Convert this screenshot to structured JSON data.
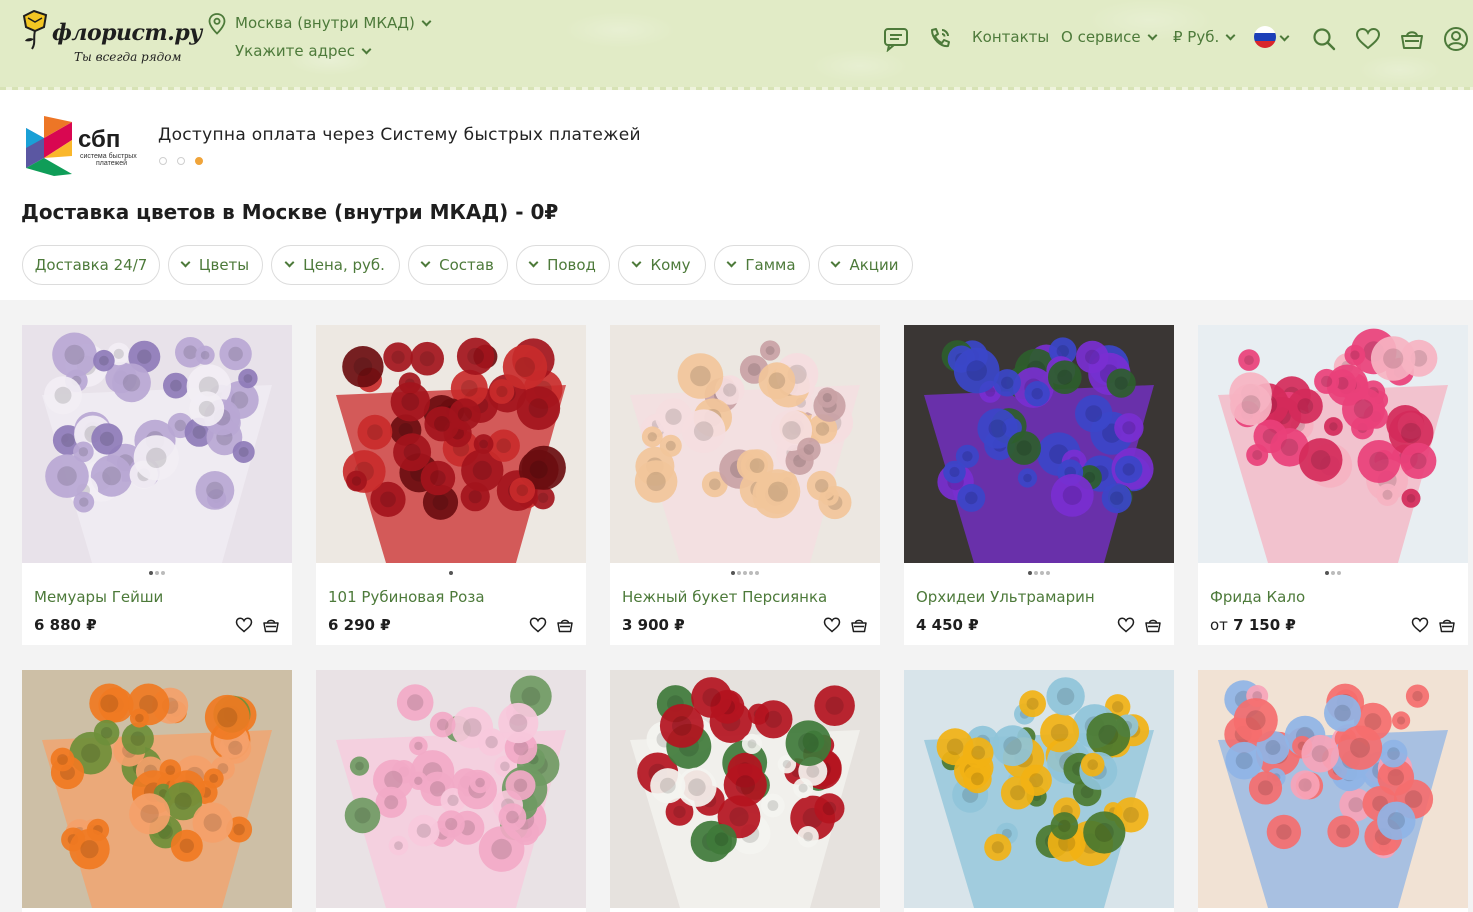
{
  "header": {
    "logo_text": "флорист.ру",
    "logo_slogan": "Ты всегда рядом",
    "city": "Москва (внутри МКАД)",
    "address_prompt": "Укажите адрес",
    "nav": {
      "contacts": "Контакты",
      "about": "О сервисе",
      "currency": "₽ Руб."
    },
    "icons": [
      "chat-icon",
      "phone-icon",
      "flag-russia-icon",
      "search-icon",
      "heart-icon",
      "basket-icon",
      "user-icon"
    ]
  },
  "banner": {
    "sbp_logo_text": "сбп",
    "sbp_logo_sub1": "система быстрых",
    "sbp_logo_sub2": "платежей",
    "text": "Доступна оплата через Систему быстрых платежей",
    "slides": 3,
    "active_slide": 3
  },
  "page_title": "Доставка цветов в Москве (внутри МКАД) - 0₽",
  "filters": [
    {
      "label": "Доставка 24/7",
      "chevron": false
    },
    {
      "label": "Цветы",
      "chevron": true
    },
    {
      "label": "Цена, руб.",
      "chevron": true
    },
    {
      "label": "Состав",
      "chevron": true
    },
    {
      "label": "Повод",
      "chevron": true
    },
    {
      "label": "Кому",
      "chevron": true
    },
    {
      "label": "Гамма",
      "chevron": true
    },
    {
      "label": "Акции",
      "chevron": true
    }
  ],
  "products": [
    {
      "name": "Мемуары Гейши",
      "price": "6 880 ₽",
      "price_prefix": "",
      "photos": 3,
      "active_photo": 1,
      "palette": [
        "#e8e2ea",
        "#b9a7d4",
        "#f2eef4",
        "#8e7bb8"
      ]
    },
    {
      "name": "101 Рубиновая Роза",
      "price": "6 290 ₽",
      "price_prefix": "",
      "photos": 1,
      "active_photo": 1,
      "palette": [
        "#ede8e2",
        "#a3141c",
        "#c92b2b",
        "#6b0d10"
      ]
    },
    {
      "name": "Нежный букет Персиянка",
      "price": "3 900 ₽",
      "price_prefix": "",
      "photos": 5,
      "active_photo": 1,
      "palette": [
        "#ece7e1",
        "#f2c69a",
        "#f5dde0",
        "#c9a2a5"
      ]
    },
    {
      "name": "Орхидеи Ультрамарин",
      "price": "4 450 ₽",
      "price_prefix": "",
      "photos": 4,
      "active_photo": 1,
      "palette": [
        "#3a3634",
        "#3b47c9",
        "#7a2fd1",
        "#2e5e2c"
      ]
    },
    {
      "name": "Фрида Кало",
      "price": "7 150 ₽",
      "price_prefix": "от",
      "photos": 3,
      "active_photo": 1,
      "palette": [
        "#e8eef2",
        "#e9407a",
        "#f6b3c2",
        "#d42a5a"
      ]
    },
    {
      "name": "",
      "price": "",
      "price_prefix": "",
      "photos": 0,
      "active_photo": 0,
      "palette": [
        "#cdbfa6",
        "#f07a22",
        "#f4a16a",
        "#6e8f3a"
      ]
    },
    {
      "name": "",
      "price": "",
      "price_prefix": "",
      "photos": 0,
      "active_photo": 0,
      "palette": [
        "#e9e2e5",
        "#f2a9c7",
        "#f7c9dc",
        "#6f9a63"
      ]
    },
    {
      "name": "",
      "price": "",
      "price_prefix": "",
      "photos": 0,
      "active_photo": 0,
      "palette": [
        "#e6e2de",
        "#b4141f",
        "#f4f4f0",
        "#3f7a3a"
      ]
    },
    {
      "name": "",
      "price": "",
      "price_prefix": "",
      "photos": 0,
      "active_photo": 0,
      "palette": [
        "#d8e4ea",
        "#f2b214",
        "#8fc4d9",
        "#4b7a2f"
      ]
    },
    {
      "name": "",
      "price": "",
      "price_prefix": "",
      "photos": 0,
      "active_photo": 0,
      "palette": [
        "#f1e2d4",
        "#f56e6e",
        "#8fb4e6",
        "#f7a4b8"
      ]
    }
  ]
}
